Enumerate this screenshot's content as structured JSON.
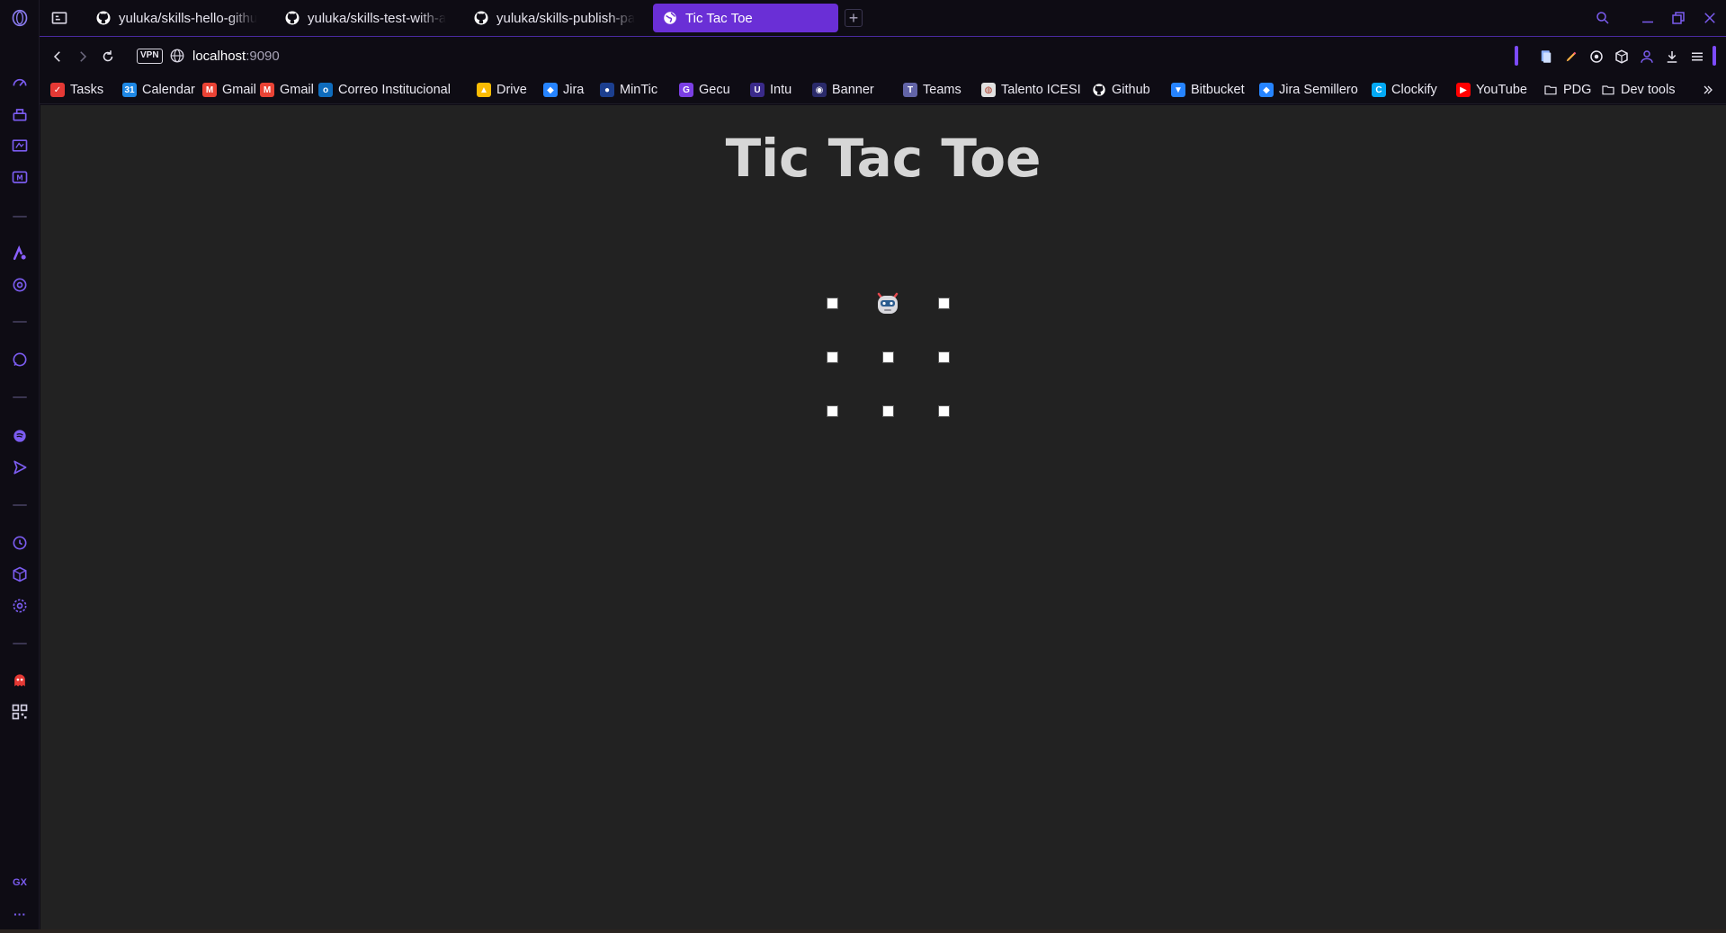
{
  "browser": {
    "accent_color": "#6a2fd6",
    "tabs": [
      {
        "label": "yuluka/skills-hello-github",
        "icon": "github-icon",
        "active": false
      },
      {
        "label": "yuluka/skills-test-with-act",
        "icon": "github-icon",
        "active": false
      },
      {
        "label": "yuluka/skills-publish-pack",
        "icon": "github-icon",
        "active": false
      },
      {
        "label": "Tic Tac Toe",
        "icon": "globe-icon",
        "active": true
      }
    ],
    "new_tab_label": "+",
    "address": {
      "vpn_label": "VPN",
      "host": "localhost",
      "port": ":9090"
    }
  },
  "bookmarks": [
    {
      "label": "Tasks",
      "icon": "tasks-icon",
      "color": "#e53935"
    },
    {
      "label": "Calendar",
      "icon": "calendar-icon",
      "color": "#1e88e5"
    },
    {
      "label": "Gmail",
      "icon": "gmail-icon",
      "color": "#ea4335"
    },
    {
      "label": "Gmail",
      "icon": "gmail-icon",
      "color": "#ea4335"
    },
    {
      "label": "Correo Institucional",
      "icon": "outlook-icon",
      "color": "#0f6cbd"
    },
    {
      "label": "Drive",
      "icon": "drive-icon",
      "color": "#fbbc04"
    },
    {
      "label": "Jira",
      "icon": "jira-icon",
      "color": "#2684ff"
    },
    {
      "label": "MinTic",
      "icon": "mintic-icon",
      "color": "#1c3f8f"
    },
    {
      "label": "Gecu",
      "icon": "gecu-icon",
      "color": "#7b3fe4"
    },
    {
      "label": "Intu",
      "icon": "intu-icon",
      "color": "#3a2a8a"
    },
    {
      "label": "Banner",
      "icon": "banner-icon",
      "color": "#2a2a6a"
    },
    {
      "label": "Teams",
      "icon": "teams-icon",
      "color": "#6264a7"
    },
    {
      "label": "Talento ICESI",
      "icon": "talento-icon",
      "color": "#e0e0e0"
    },
    {
      "label": "Github",
      "icon": "github-icon",
      "color": "#ffffff"
    },
    {
      "label": "Bitbucket",
      "icon": "bitbucket-icon",
      "color": "#2684ff"
    },
    {
      "label": "Jira Semillero",
      "icon": "jira-icon",
      "color": "#2684ff"
    },
    {
      "label": "Clockify",
      "icon": "clockify-icon",
      "color": "#03a9f4"
    },
    {
      "label": "YouTube",
      "icon": "youtube-icon",
      "color": "#ff0000"
    },
    {
      "label": "PDG",
      "icon": "folder-icon",
      "color": "#e8e6ef"
    },
    {
      "label": "Dev tools",
      "icon": "folder-icon",
      "color": "#e8e6ef"
    }
  ],
  "page": {
    "title": "Tic Tac Toe",
    "board": [
      [
        "empty",
        "robot",
        "empty"
      ],
      [
        "empty",
        "empty",
        "empty"
      ],
      [
        "empty",
        "empty",
        "empty"
      ]
    ],
    "background": "#222222"
  },
  "sidebar": {
    "items": [
      "opera-logo-icon",
      "speed-dial-icon",
      "aria-icon",
      "sports-icon",
      "tv-icon",
      "aria-ai-icon",
      "chatgpt-icon",
      "whatsapp-icon",
      "spotify-icon",
      "send-icon",
      "history-icon",
      "extensions-icon",
      "settings-icon",
      "ghost-icon",
      "qr-code-icon",
      "gx-icon",
      "more-icon"
    ],
    "gx_label": "GX",
    "more_label": "···"
  }
}
